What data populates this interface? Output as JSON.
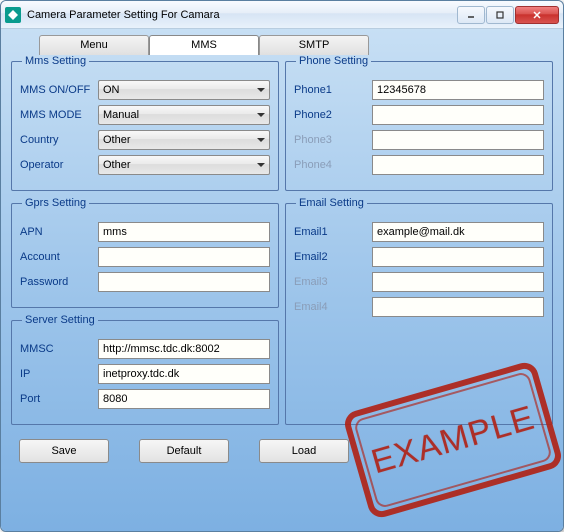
{
  "window": {
    "title": "Camera Parameter Setting For  Camara"
  },
  "tabs": {
    "menu": "Menu",
    "mms": "MMS",
    "smtp": "SMTP"
  },
  "mmsSetting": {
    "legend": "Mms Setting",
    "fields": {
      "onoff": {
        "label": "MMS ON/OFF",
        "value": "ON"
      },
      "mode": {
        "label": "MMS MODE",
        "value": "Manual"
      },
      "country": {
        "label": "Country",
        "value": "Other"
      },
      "operator": {
        "label": "Operator",
        "value": "Other"
      }
    }
  },
  "gprsSetting": {
    "legend": "Gprs Setting",
    "fields": {
      "apn": {
        "label": "APN",
        "value": "mms"
      },
      "account": {
        "label": "Account",
        "value": ""
      },
      "password": {
        "label": "Password",
        "value": ""
      }
    }
  },
  "serverSetting": {
    "legend": "Server Setting",
    "fields": {
      "mmsc": {
        "label": "MMSC",
        "value": "http://mmsc.tdc.dk:8002"
      },
      "ip": {
        "label": "IP",
        "value": "inetproxy.tdc.dk"
      },
      "port": {
        "label": "Port",
        "value": "8080"
      }
    }
  },
  "phoneSetting": {
    "legend": "Phone Setting",
    "fields": {
      "phone1": {
        "label": "Phone1",
        "value": "12345678",
        "enabled": true
      },
      "phone2": {
        "label": "Phone2",
        "value": "",
        "enabled": true
      },
      "phone3": {
        "label": "Phone3",
        "value": "",
        "enabled": false
      },
      "phone4": {
        "label": "Phone4",
        "value": "",
        "enabled": false
      }
    }
  },
  "emailSetting": {
    "legend": "Email Setting",
    "fields": {
      "email1": {
        "label": "Email1",
        "value": "example@mail.dk",
        "enabled": true
      },
      "email2": {
        "label": "Email2",
        "value": "",
        "enabled": true
      },
      "email3": {
        "label": "Email3",
        "value": "",
        "enabled": false
      },
      "email4": {
        "label": "Email4",
        "value": "",
        "enabled": false
      }
    }
  },
  "buttons": {
    "save": "Save",
    "default": "Default",
    "load": "Load"
  },
  "stamp": "EXAMPLE"
}
